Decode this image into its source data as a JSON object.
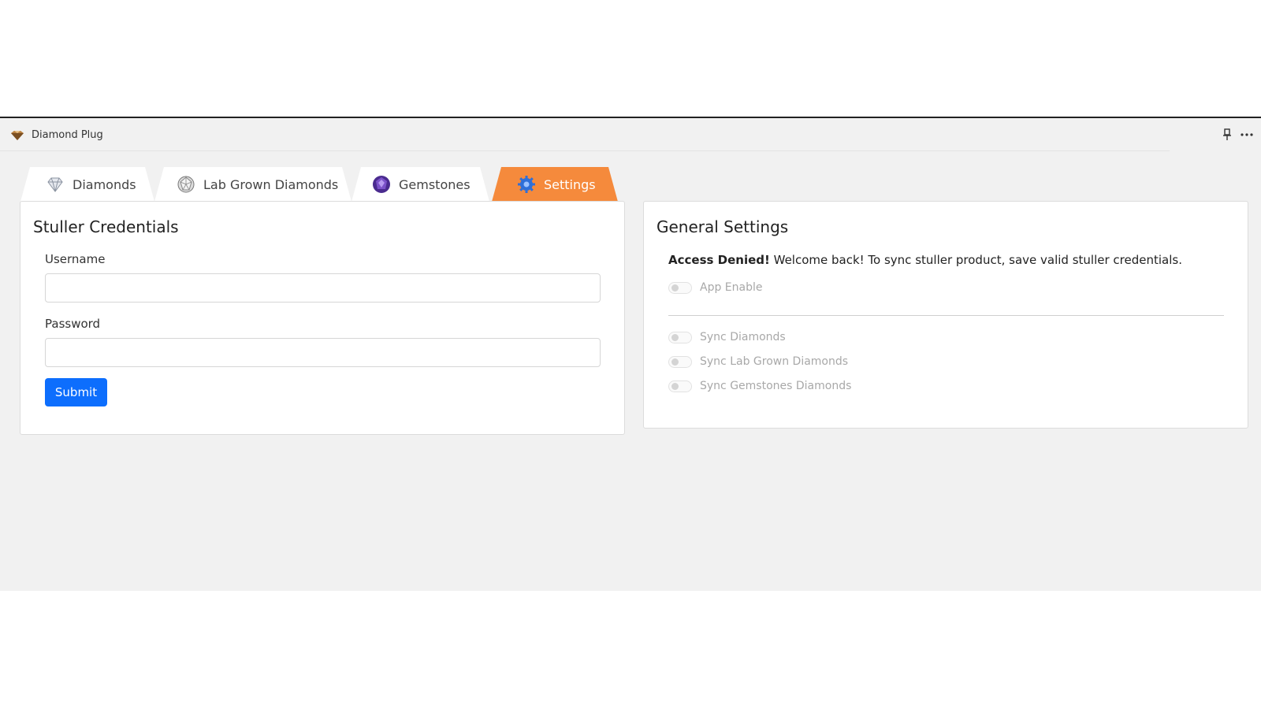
{
  "app": {
    "title": "Diamond Plug"
  },
  "tabs": [
    {
      "label": "Diamonds",
      "icon": "diamond-icon",
      "active": false
    },
    {
      "label": "Lab Grown Diamonds",
      "icon": "lab-diamond-icon",
      "active": false
    },
    {
      "label": "Gemstones",
      "icon": "gemstone-icon",
      "active": false
    },
    {
      "label": "Settings",
      "icon": "gear-icon",
      "active": true
    }
  ],
  "credentials": {
    "title": "Stuller Credentials",
    "username_label": "Username",
    "username_value": "",
    "password_label": "Password",
    "password_value": "",
    "submit_label": "Submit"
  },
  "general": {
    "title": "General Settings",
    "notice_bold": "Access Denied!",
    "notice_text": " Welcome back! To sync stuller product, save valid stuller credentials.",
    "app_enable_label": "App Enable",
    "sync_diamonds_label": "Sync Diamonds",
    "sync_lab_label": "Sync Lab Grown Diamonds",
    "sync_gem_label": "Sync Gemstones Diamonds"
  },
  "colors": {
    "active_tab": "#f58a3c",
    "primary_button": "#0d6efd",
    "background": "#f1f1f1"
  }
}
